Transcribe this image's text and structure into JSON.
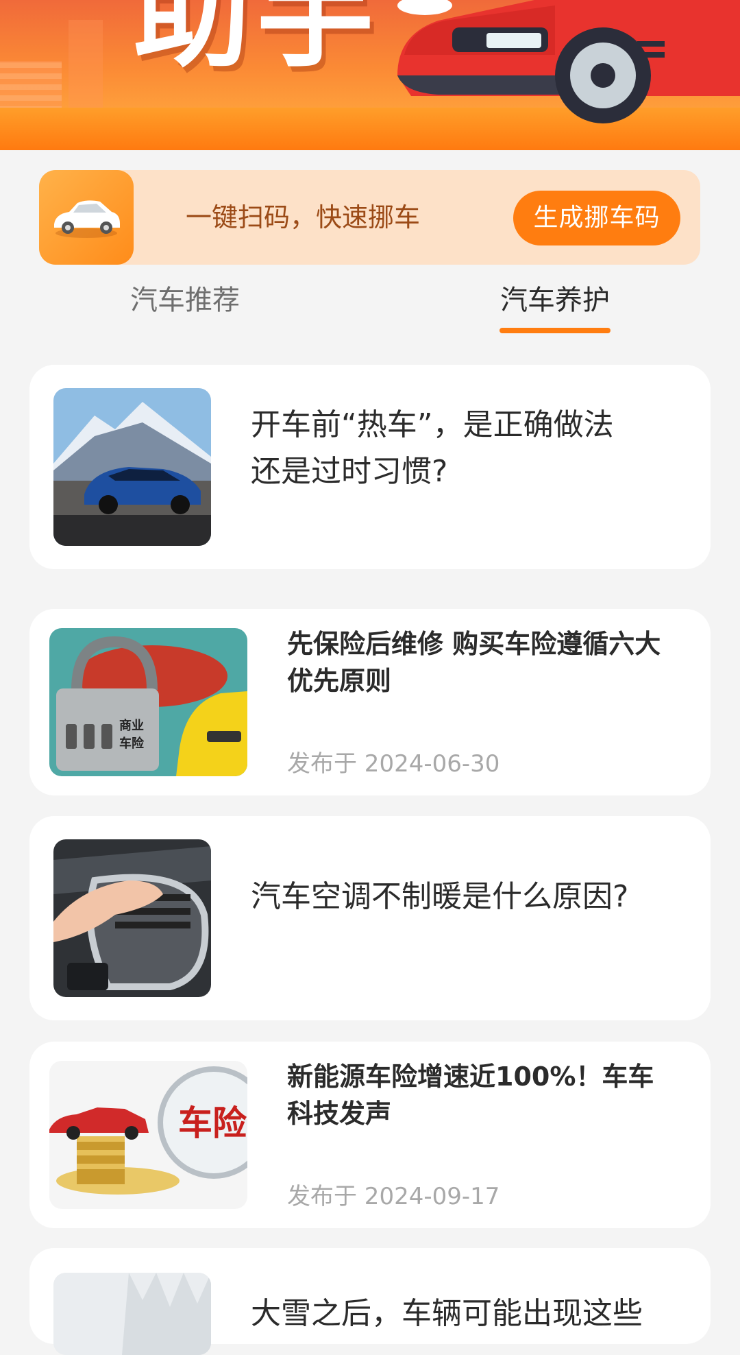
{
  "banner": {
    "title": "助手"
  },
  "move_car": {
    "text": "一键扫码，快速挪车",
    "button_label": "生成挪车码"
  },
  "tabs": [
    {
      "label": "汽车推荐",
      "active": false
    },
    {
      "label": "汽车养护",
      "active": true
    }
  ],
  "articles": [
    {
      "title_line1": "开车前“热车”，是正确做法",
      "title_line2": "还是过时习惯?",
      "date": ""
    },
    {
      "title_line1": "先保险后维修 购买车险遵循六大",
      "title_line2": "优先原则",
      "date": "发布于 2024-06-30"
    },
    {
      "title_line1": "汽车空调不制暖是什么原因?",
      "title_line2": "",
      "date": ""
    },
    {
      "title_line1": "新能源车险增速近100%！车车",
      "title_line2": "科技发声",
      "date": "发布于 2024-09-17"
    },
    {
      "title_line1": "大雪之后，车辆可能出现这些",
      "title_line2": "",
      "date": ""
    }
  ],
  "thumb_labels": {
    "lock": "商业\n车险",
    "badge": "车险"
  },
  "colors": {
    "accent": "#ff7d10",
    "bar_bg": "#fde1c8",
    "page_bg": "#f4f4f4"
  }
}
